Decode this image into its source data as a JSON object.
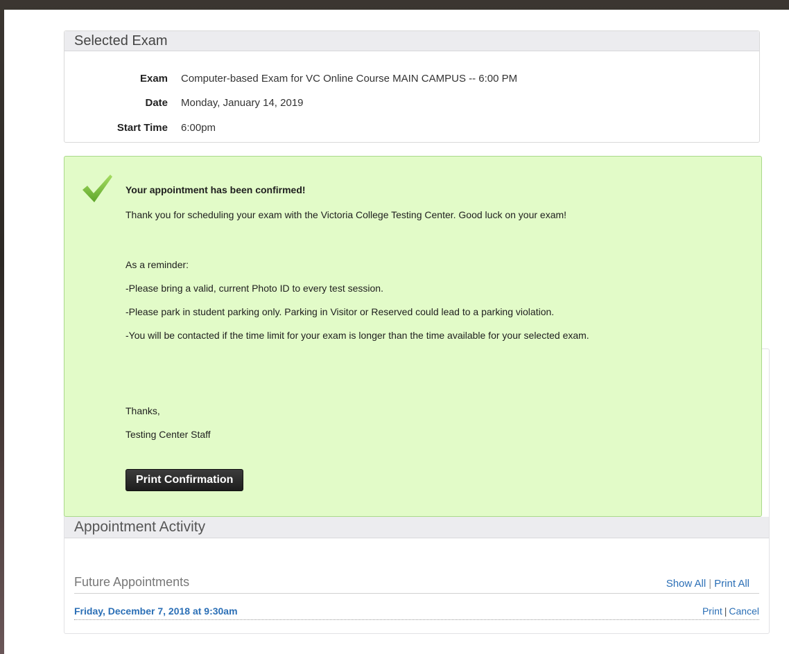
{
  "selected_exam": {
    "title": "Selected Exam",
    "exam_label": "Exam",
    "exam_value": "Computer-based Exam for VC Online Course MAIN CAMPUS -- 6:00 PM",
    "date_label": "Date",
    "date_value": "Monday, January 14, 2019",
    "start_label": "Start Time",
    "start_value": "6:00pm"
  },
  "confirmation": {
    "heading": "Your appointment has been confirmed!",
    "thank_you": "Thank you for scheduling your exam with the Victoria College Testing Center.  Good luck on your exam!",
    "reminder_intro": "As a reminder:",
    "reminders": [
      "-Please bring a valid, current Photo ID to every test session.",
      "-Please park in student parking only. Parking in Visitor or Reserved could lead to a parking violation.",
      "-You will be contacted if the time limit for your exam is longer than the time available for your selected exam."
    ],
    "closing": "Thanks,",
    "signature": "Testing Center Staff",
    "print_button": "Print Confirmation",
    "icon": "checkmark-icon",
    "icon_color": "#7cc242",
    "background_color": "#e2fbc8"
  },
  "activity": {
    "title": "Appointment Activity",
    "future_title": "Future Appointments",
    "show_all": "Show All",
    "separator": "|",
    "print_all": "Print All",
    "appointments": [
      {
        "date": "Friday, December 7, 2018 at 9:30am",
        "print": "Print",
        "cancel": "Cancel"
      }
    ]
  }
}
